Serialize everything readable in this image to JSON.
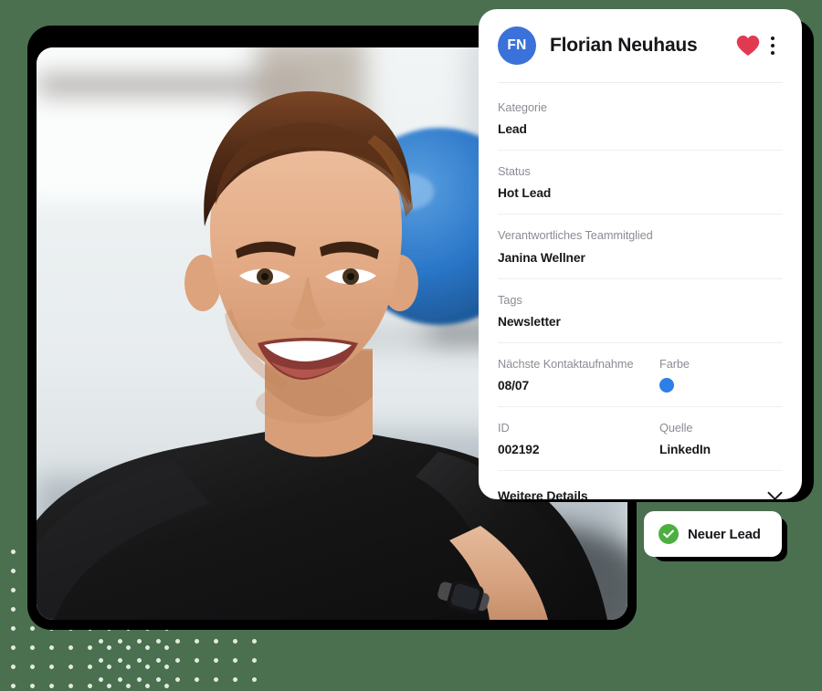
{
  "theme": {
    "page_background": "#4a7050",
    "card_background": "#ffffff",
    "frame_color": "#000000",
    "avatar_color": "#3b72d9",
    "heart_color": "#e03a52",
    "farbe_dot_color": "#2d7fe8",
    "check_color": "#4caf3f"
  },
  "card": {
    "avatar_initials": "FN",
    "title": "Florian Neuhaus",
    "heart_icon": "heart-filled-icon",
    "menu_icon": "kebab-menu-icon",
    "fields": [
      {
        "label": "Kategorie",
        "value": "Lead"
      },
      {
        "label": "Status",
        "value": "Hot Lead"
      },
      {
        "label": "Verantwortliches Teammitglied",
        "value": "Janina Wellner"
      },
      {
        "label": "Tags",
        "value": "Newsletter"
      },
      {
        "label": "Nächste Kontaktaufnahme",
        "value": "08/07",
        "label_right": "Farbe",
        "value_right_is_color": true
      },
      {
        "label": "ID",
        "value": "002192",
        "label_right": "Quelle",
        "value_right": "LinkedIn"
      }
    ],
    "footer": {
      "label": "Weitere Details",
      "chevron_icon": "chevron-down-icon"
    }
  },
  "lead_button": {
    "label": "Neuer Lead",
    "icon": "check-circle-icon"
  },
  "photo": {
    "alt": "portrait-smiling-man-black-tshirt-gym"
  }
}
